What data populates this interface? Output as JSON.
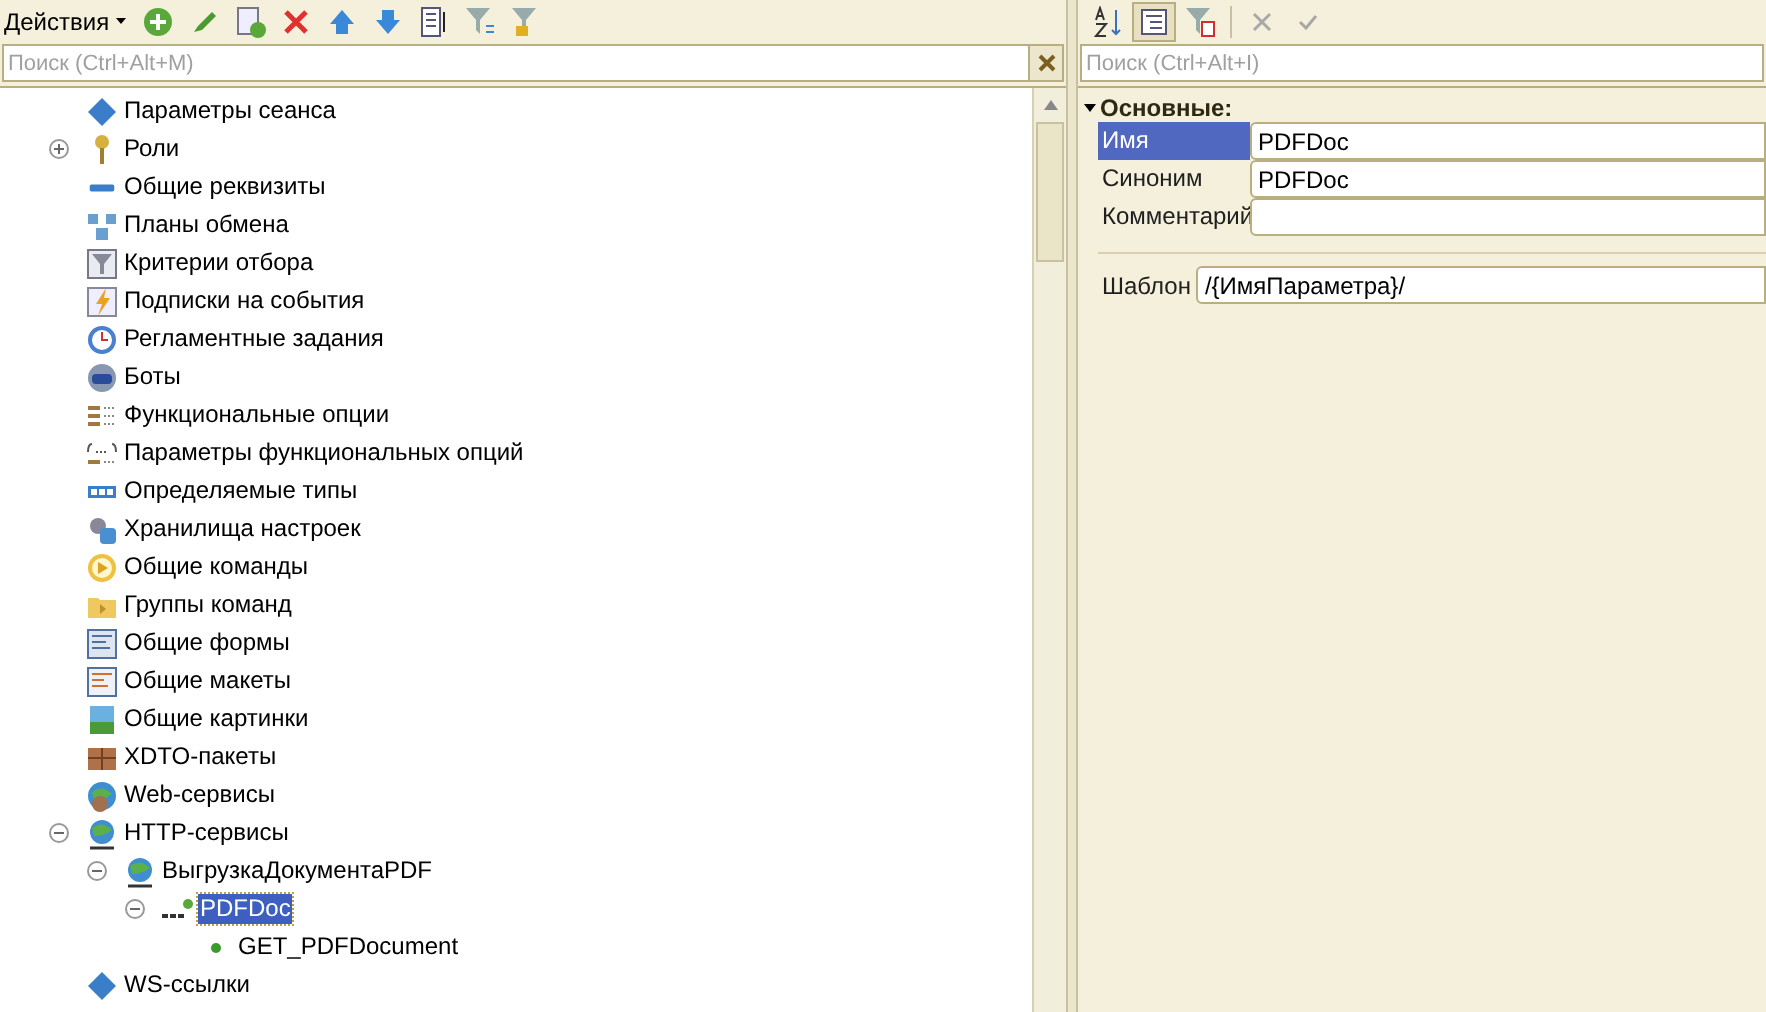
{
  "left_toolbar": {
    "actions_menu": "Действия"
  },
  "left_search": {
    "placeholder": "Поиск (Ctrl+Alt+M)"
  },
  "tree": [
    {
      "label": "Параметры сеанса",
      "selected": false
    },
    {
      "label": "Роли",
      "expanded": false,
      "selected": false
    },
    {
      "label": "Общие реквизиты",
      "selected": false
    },
    {
      "label": "Планы обмена",
      "selected": false
    },
    {
      "label": "Критерии отбора",
      "selected": false
    },
    {
      "label": "Подписки на события",
      "selected": false
    },
    {
      "label": "Регламентные задания",
      "selected": false
    },
    {
      "label": "Боты",
      "selected": false
    },
    {
      "label": "Функциональные опции",
      "selected": false
    },
    {
      "label": "Параметры функциональных опций",
      "selected": false
    },
    {
      "label": "Определяемые типы",
      "selected": false
    },
    {
      "label": "Хранилища настроек",
      "selected": false
    },
    {
      "label": "Общие команды",
      "selected": false
    },
    {
      "label": "Группы команд",
      "selected": false
    },
    {
      "label": "Общие формы",
      "selected": false
    },
    {
      "label": "Общие макеты",
      "selected": false
    },
    {
      "label": "Общие картинки",
      "selected": false
    },
    {
      "label": "XDTO-пакеты",
      "selected": false
    },
    {
      "label": "Web-сервисы",
      "selected": false
    },
    {
      "label": "HTTP-сервисы",
      "expanded": true,
      "selected": false,
      "children": [
        {
          "label": "ВыгрузкаДокументаPDF",
          "expanded": true,
          "selected": false,
          "children": [
            {
              "label": "PDFDoc",
              "expanded": true,
              "selected": true,
              "children": [
                {
                  "label": "GET_PDFDocument",
                  "selected": false
                }
              ]
            }
          ]
        }
      ]
    },
    {
      "label": "WS-ссылки",
      "selected": false
    }
  ],
  "right_search": {
    "placeholder": "Поиск (Ctrl+Alt+I)"
  },
  "properties": {
    "section": "Основные:",
    "expanded": true,
    "fields": [
      {
        "label": "Имя",
        "value": "PDFDoc",
        "selected": true
      },
      {
        "label": "Синоним",
        "value": "PDFDoc",
        "selected": false
      },
      {
        "label": "Комментарий",
        "selected": false
      }
    ],
    "template": {
      "label": "Шаблон",
      "value": "/{ИмяПараметра}/"
    }
  }
}
